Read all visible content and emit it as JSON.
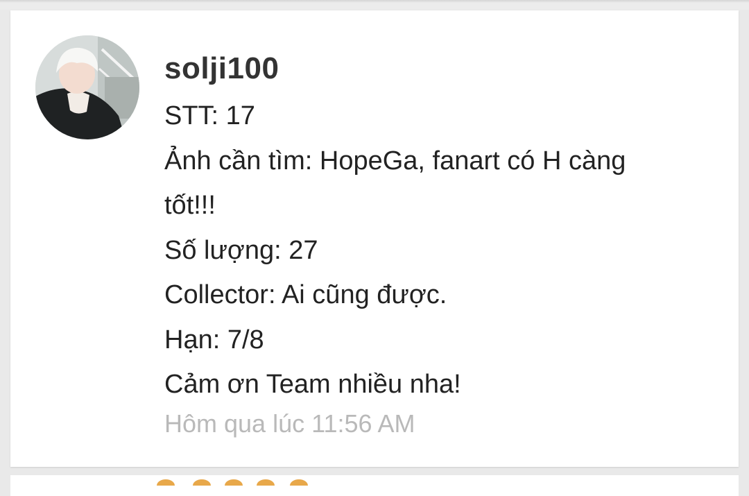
{
  "post": {
    "username": "solji100",
    "lines": [
      "STT: 17",
      "Ảnh cần tìm: HopeGa, fanart có H càng",
      "tốt!!!",
      "Số lượng: 27",
      "Collector: Ai cũng được.",
      "Hạn: 7/8",
      "Cảm ơn Team nhiều nha!"
    ],
    "timestamp": "Hôm qua lúc 11:56 AM"
  },
  "colors": {
    "username": "#333333",
    "text": "#222222",
    "timestamp": "#b9b9b9",
    "next_name_accent": "#e8a84a"
  }
}
